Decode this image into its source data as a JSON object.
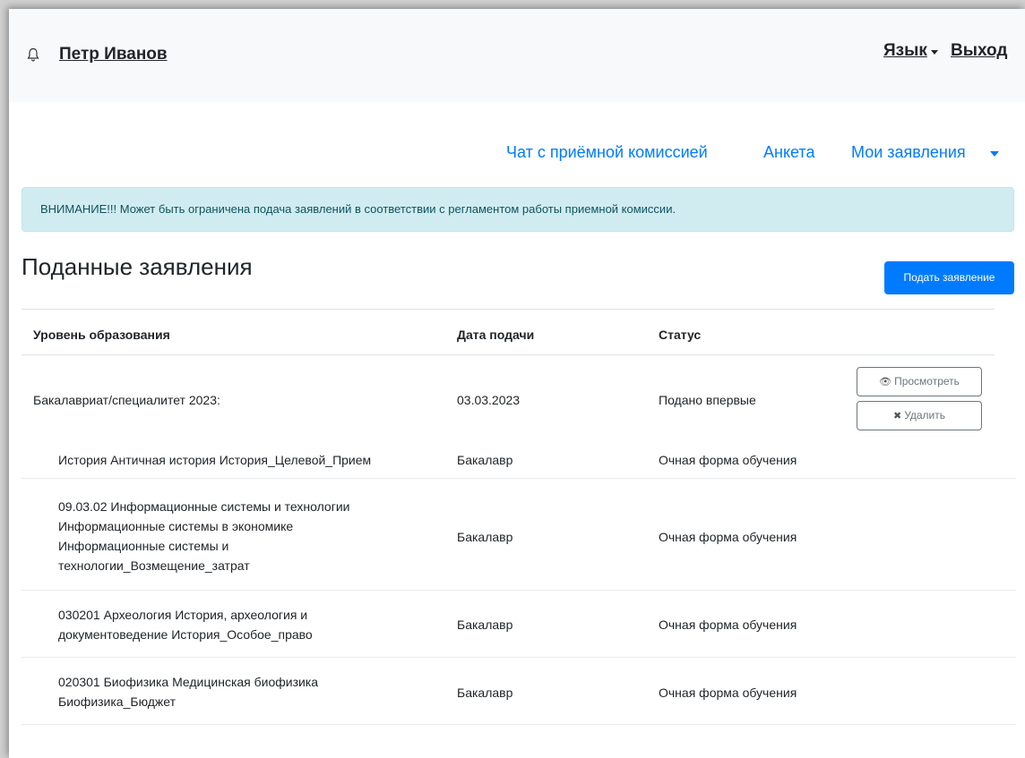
{
  "header": {
    "user_name": "Петр Иванов",
    "language_label": "Язык",
    "logout_label": "Выход",
    "bell_icon": "bell-icon"
  },
  "nav": {
    "chat_label": "Чат с приёмной комиссией",
    "form_label": "Анкета",
    "applications_label": "Мои заявления"
  },
  "alert": {
    "text": "ВНИМАНИЕ!!! Может быть ограничена подача заявлений в соответствии с регламентом работы приемной комиссии."
  },
  "page": {
    "title": "Поданные заявления",
    "submit_label": "Подать заявление"
  },
  "table": {
    "headers": [
      "Уровень образования",
      "Дата подачи",
      "Статус"
    ],
    "application": {
      "level": "Бакалавриат/специалитет 2023:",
      "date": "03.03.2023",
      "status": "Подано впервые",
      "view_label": "Просмотреть",
      "delete_label": "Удалить"
    },
    "programs": [
      {
        "lines": [
          "История Античная история История_Целевой_Прием"
        ],
        "degree": "Бакалавр",
        "form": "Очная форма обучения"
      },
      {
        "lines": [
          "09.03.02 Информационные системы и технологии",
          "Информационные системы в экономике",
          "Информационные системы и",
          "технологии_Возмещение_затрат"
        ],
        "degree": "Бакалавр",
        "form": "Очная форма обучения"
      },
      {
        "lines": [
          "030201 Археология История, археология и",
          "документоведение История_Особое_право"
        ],
        "degree": "Бакалавр",
        "form": "Очная форма обучения"
      },
      {
        "lines": [
          "020301 Биофизика Медицинская биофизика",
          "Биофизика_Бюджет"
        ],
        "degree": "Бакалавр",
        "form": "Очная форма обучения"
      }
    ]
  },
  "colors": {
    "link_blue": "#007bff",
    "alert_bg": "#d1ecf1",
    "alert_text": "#0c5460",
    "topbar_bg": "#f8f9fa"
  }
}
